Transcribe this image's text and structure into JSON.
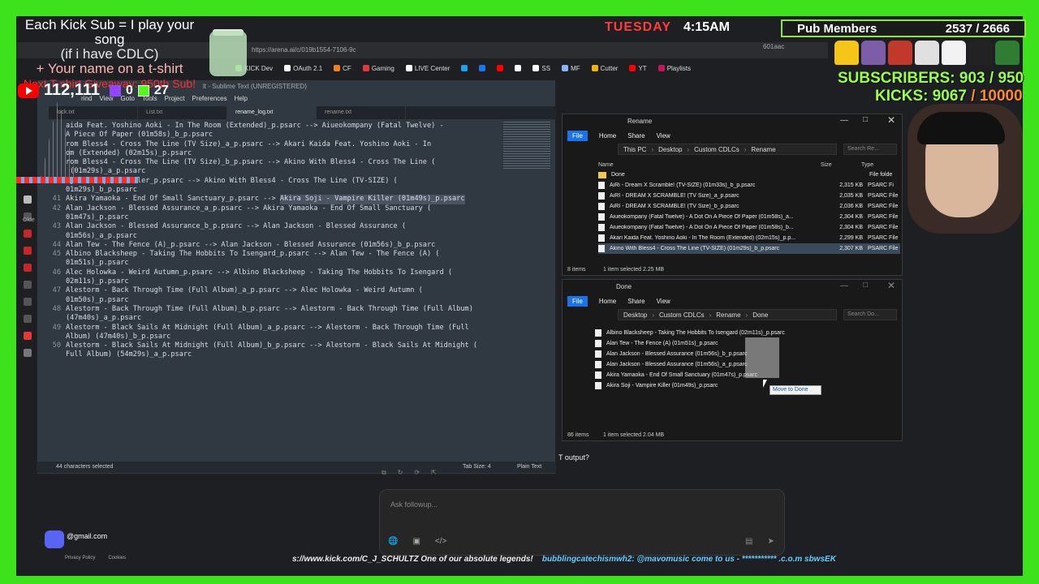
{
  "overlay": {
    "line1": "Each Kick Sub = I play your song",
    "line2": "(if i have CDLC)",
    "line3": "+ Your name on a t-shirt",
    "line4": "Next T-shirt Giveaway: 950th Sub!",
    "youtube_subs": "112,111",
    "twitch_subs": "0",
    "kick_subs": "27",
    "day": "TUESDAY",
    "time": "4:15AM",
    "pub_label": "Pub Members",
    "pub_count": "2537 / 2666",
    "subscribers_label": "SUBSCRIBERS:",
    "subscribers_value": "903 / 950",
    "kicks_label": "KICKS:",
    "kicks_value": "9067",
    "kicks_goal": "/ 10000",
    "ticker_a": "s://www.kick.com/C_J_SCHULTZ One of our absolute legends!",
    "ticker_b": "bubblingcatechismwh2: @mavomusic come to us - *********** .c.o.m sbwsEK",
    "email": "@gmail.com",
    "privacy": "Privacy Policy",
    "cookies": "Cookies"
  },
  "browser": {
    "url": "https://arena.ai/c/019b1554-7106-9c",
    "tab_tail": "601aac",
    "bookmarks": [
      {
        "label": "KICK Dev",
        "color": "#53fc18"
      },
      {
        "label": "OAuth 2.1",
        "color": "#ffffff"
      },
      {
        "label": "CF",
        "color": "#f38020"
      },
      {
        "label": "Gaming",
        "color": "#e53935"
      },
      {
        "label": "LIVE Center",
        "color": "#ffffff"
      },
      {
        "label": "",
        "color": "#1da1f2"
      },
      {
        "label": "",
        "color": "#1877f2"
      },
      {
        "label": "",
        "color": "#ff0000"
      },
      {
        "label": "",
        "color": "#ffffff"
      },
      {
        "label": "SS",
        "color": "#ffffff"
      },
      {
        "label": "MF",
        "color": "#8ab4f8"
      },
      {
        "label": "Cutter",
        "color": "#f4b400"
      },
      {
        "label": "YT",
        "color": "#ff0000"
      },
      {
        "label": "Playlists",
        "color": "#c2185b"
      }
    ],
    "older": "Olde",
    "output_question": "T output?",
    "ask_placeholder": "Ask followup..."
  },
  "sublime": {
    "title": "lt - Sublime Text (UNREGISTERED)",
    "menu": [
      "rind",
      "View",
      "Goto",
      "Tools",
      "Project",
      "Preferences",
      "Help"
    ],
    "tabs": [
      "lock.txt",
      "List.txt",
      "rename_log.txt",
      "rename.txt"
    ],
    "status_left": "44 characters selected",
    "tab_size": "Tab Size: 4",
    "syntax": "Plain Text",
    "lines": [
      {
        "n": "",
        "t": "aida Feat. Yoshino Aoki - In The Room (Extended)_p.psarc --> Aiueokompany (Fatal Twelve) -"
      },
      {
        "n": "",
        "t": "A Piece Of Paper (01m58s)_b_p.psarc"
      },
      {
        "n": "",
        "t": "rom Bless4 - Cross The Line (TV Size)_a_p.psarc --> Akari Kaida Feat. Yoshino Aoki - In"
      },
      {
        "n": "",
        "t": "om (Extended) (02m15s)_p.psarc"
      },
      {
        "n": "",
        "t": "rom Bless4 - Cross The Line (TV Size)_b_p.psarc --> Akino With Bless4 - Cross The Line ("
      },
      {
        "n": "",
        "t": " (01m29s)_a_p.psarc"
      },
      {
        "n": "",
        "t": "oji - Vampire Killer_p.psarc --> Akino With Bless4 - Cross The Line (TV-SIZE) ("
      },
      {
        "n": "",
        "t": "01m29s)_b_p.psarc"
      },
      {
        "n": "41",
        "t": "Akira Yamaoka - End Of Small Sanctuary_p.psarc --> ",
        "h": "Akira Soji - Vampire Killer (01m49s)_p.psarc"
      },
      {
        "n": "42",
        "t": "Alan Jackson - Blessed Assurance_a_p.psarc --> Akira Yamaoka - End Of Small Sanctuary ("
      },
      {
        "n": "",
        "t": "01m47s)_p.psarc"
      },
      {
        "n": "43",
        "t": "Alan Jackson - Blessed Assurance_b_p.psarc --> Alan Jackson - Blessed Assurance ("
      },
      {
        "n": "",
        "t": "01m56s)_a_p.psarc"
      },
      {
        "n": "44",
        "t": "Alan Tew - The Fence (A)_p.psarc --> Alan Jackson - Blessed Assurance (01m56s)_b_p.psarc"
      },
      {
        "n": "45",
        "t": "Albino Blacksheep - Taking The Hobbits To Isengard_p.psarc --> Alan Tew - The Fence (A) ("
      },
      {
        "n": "",
        "t": "01m51s)_p.psarc"
      },
      {
        "n": "46",
        "t": "Alec Holowka - Weird Autumn_p.psarc --> Albino Blacksheep - Taking The Hobbits To Isengard ("
      },
      {
        "n": "",
        "t": "02m11s)_p.psarc"
      },
      {
        "n": "47",
        "t": "Alestorm - Back Through Time (Full Album)_a_p.psarc --> Alec Holowka - Weird Autumn ("
      },
      {
        "n": "",
        "t": "01m50s)_p.psarc"
      },
      {
        "n": "48",
        "t": "Alestorm - Back Through Time (Full Album)_b_p.psarc --> Alestorm - Back Through Time (Full Album)"
      },
      {
        "n": "",
        "t": "(47m40s)_a_p.psarc"
      },
      {
        "n": "49",
        "t": "Alestorm - Black Sails At Midnight (Full Album)_a_p.psarc --> Alestorm - Back Through Time (Full"
      },
      {
        "n": "",
        "t": "Album) (47m40s)_b_p.psarc"
      },
      {
        "n": "50",
        "t": "Alestorm - Black Sails At Midnight (Full Album)_b_p.psarc --> Alestorm - Black Sails At Midnight ("
      },
      {
        "n": "",
        "t": "Full Album) (54m29s)_a_p.psarc"
      }
    ]
  },
  "explorer1": {
    "title": "Rename",
    "ribbon": [
      "File",
      "Home",
      "Share",
      "View"
    ],
    "path": [
      "This PC",
      "Desktop",
      "Custom CDLCs",
      "Rename"
    ],
    "search": "Search Re...",
    "col_name": "Name",
    "col_size": "Size",
    "col_type": "Type",
    "folder": {
      "name": "Done",
      "type": "File folde"
    },
    "files": [
      {
        "name": "AiRi - Dream X Scramble! (TV-SIZE) (01m33s)_b_p.psarc",
        "size": "2,315 KB",
        "type": "PSARC Fi"
      },
      {
        "name": "AiRI - DREAM X SCRAMBLE! (TV Size)_a_p.psarc",
        "size": "2,035 KB",
        "type": "PSARC File"
      },
      {
        "name": "AiRI - DREAM X SCRAMBLE! (TV Size)_b_p.psarc",
        "size": "2,036 KB",
        "type": "PSARC File"
      },
      {
        "name": "Aiueokompany (Fatal Twelve) - A Dot On A Piece Of Paper (01m58s)_a...",
        "size": "2,304 KB",
        "type": "PSARC File"
      },
      {
        "name": "Aiueokompany (Fatal Twelve) - A Dot On A Piece Of Paper (01m58s)_b...",
        "size": "2,304 KB",
        "type": "PSARC File"
      },
      {
        "name": "Akari Kaida Feat. Yoshino Aoki - In The Room (Extended) (02m15s)_p.p...",
        "size": "2,299 KB",
        "type": "PSARC File"
      },
      {
        "name": "Akino With Bless4 - Cross The Line (TV-SIZE) (01m29s)_b_p.psarc",
        "size": "2,307 KB",
        "type": "PSARC File"
      }
    ],
    "status_items": "8 items",
    "status_sel": "1 item selected  2.25 MB"
  },
  "explorer2": {
    "title": "Done",
    "ribbon": [
      "File",
      "Home",
      "Share",
      "View"
    ],
    "path": [
      "Desktop",
      "Custom CDLCs",
      "Rename",
      "Done"
    ],
    "search": "Search Do...",
    "files": [
      {
        "name": "Albino Blacksheep - Taking The Hobbits To Isengard (02m11s)_p.psarc"
      },
      {
        "name": "Alan Tew - The Fence (A) (01m51s)_p.psarc"
      },
      {
        "name": "Alan Jackson - Blessed Assurance (01m56s)_b_p.psarc"
      },
      {
        "name": "Alan Jackson - Blessed Assurance (01m56s)_a_p.psarc"
      },
      {
        "name": "Akira Yamaoka - End Of Small Sanctuary (01m47s)_p.psarc"
      },
      {
        "name": "Akira Soji - Vampire Killer (01m49s)_p.psarc"
      }
    ],
    "tooltip": "Move to Done",
    "status_items": "86 items",
    "status_sel": "1 item selected  2.04 MB"
  },
  "colors": {
    "green_screen": "#3ee21c",
    "kick_green": "#9bff4a",
    "time_red": "#ff3b3b",
    "selection": "#3b4a5a"
  }
}
